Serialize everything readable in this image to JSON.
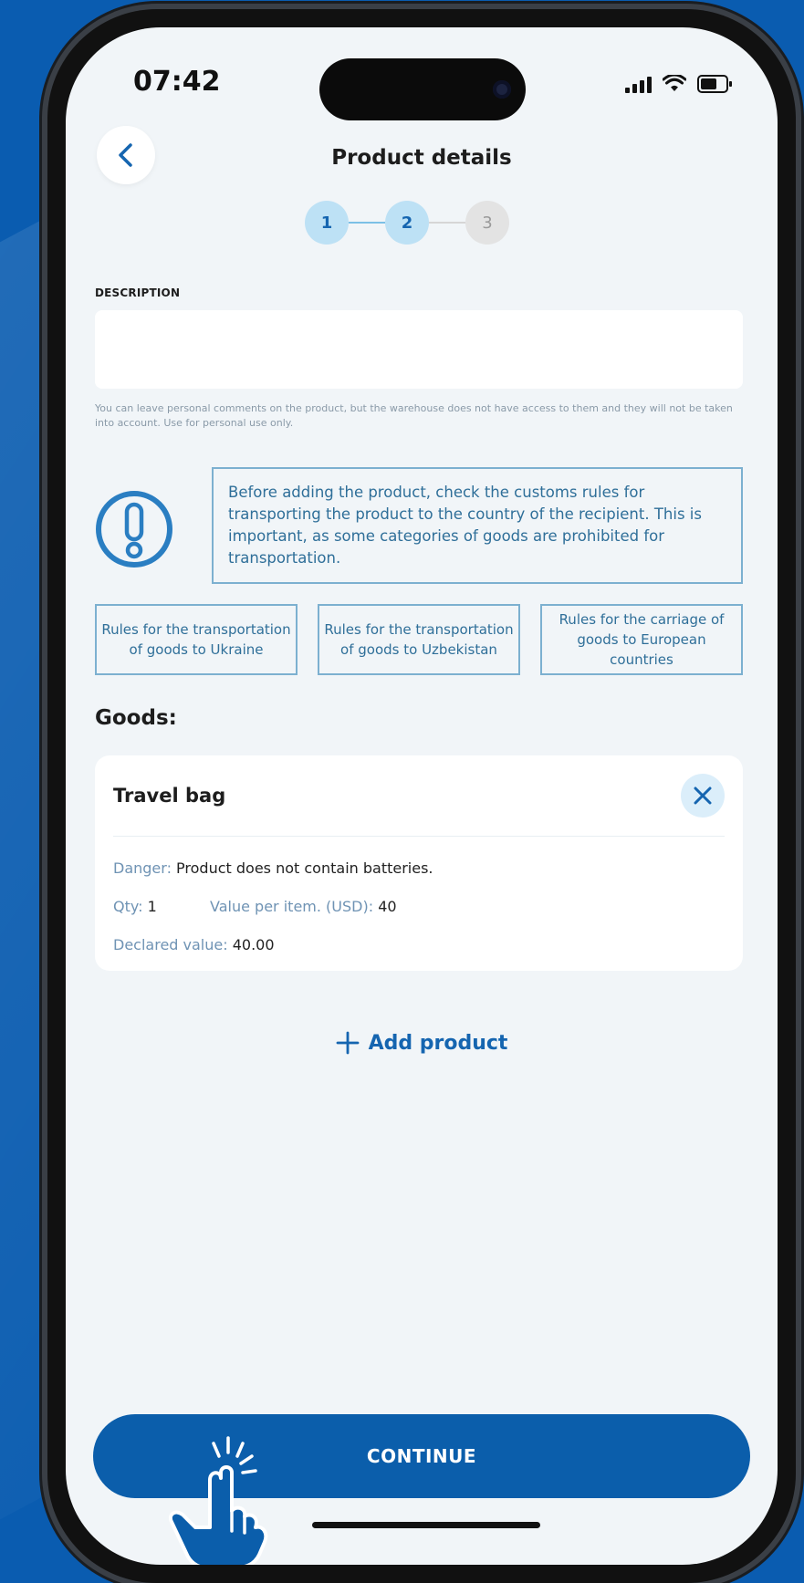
{
  "status_bar": {
    "time": "07:42"
  },
  "header": {
    "title": "Product details"
  },
  "stepper": {
    "steps": [
      "1",
      "2",
      "3"
    ],
    "current_step": 2
  },
  "description": {
    "label": "DESCRIPTION",
    "value": "",
    "hint": "You can leave personal comments on the product, but the warehouse does not have access to them and they will not be taken into account. Use for personal use only."
  },
  "warning": {
    "text": "Before adding the product, check the customs rules for transporting the product to the country of the recipient. This is important, as some categories of goods are prohibited for transportation."
  },
  "rules": [
    {
      "label": "Rules for the transportation of goods to Ukraine"
    },
    {
      "label": "Rules for the transportation of goods to Uzbekistan"
    },
    {
      "label": "Rules for the carriage of goods to European countries"
    }
  ],
  "goods": {
    "title": "Goods:",
    "items": [
      {
        "name": "Travel bag",
        "danger_label": "Danger:",
        "danger_value": "Product does not contain batteries.",
        "qty_label": "Qty:",
        "qty_value": "1",
        "value_label": "Value per item. (USD):",
        "value_value": "40",
        "declared_label": "Declared value:",
        "declared_value": "40.00"
      }
    ]
  },
  "actions": {
    "add_product": "Add product",
    "continue": "CONTINUE"
  },
  "colors": {
    "primary": "#0b5eab",
    "accent_text": "#2f6f99",
    "background": "#0a5cb0"
  },
  "icons": [
    "back-chevron-icon",
    "warning-exclamation-icon",
    "close-icon",
    "plus-icon",
    "tap-hand-icon"
  ]
}
